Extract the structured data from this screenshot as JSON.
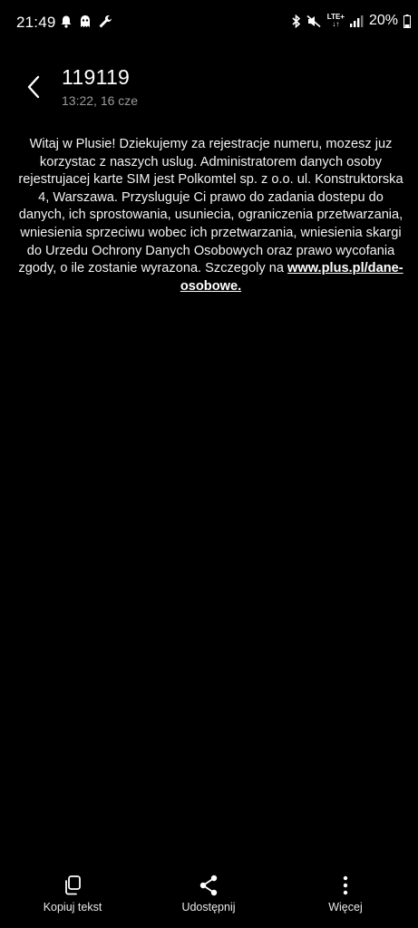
{
  "status_bar": {
    "time": "21:49",
    "network_label": "LTE+",
    "battery_percent": "20%",
    "icons": [
      "bell-icon",
      "ghost-icon",
      "wrench-icon",
      "bluetooth-icon",
      "mute-icon",
      "signal-icon",
      "battery-icon"
    ]
  },
  "header": {
    "sender": "119119",
    "timestamp": "13:22, 16 cze"
  },
  "message": {
    "body": "Witaj w Plusie! Dziekujemy za rejestracje numeru, mozesz juz korzystac z naszych uslug. Administratorem danych osoby rejestrujacej karte SIM jest Polkomtel sp. z o.o. ul. Konstruktorska 4, Warszawa. Przysluguje Ci prawo do zadania dostepu do danych, ich sprostowania, usuniecia, ograniczenia przetwarzania, wniesienia sprzeciwu wobec ich przetwarzania, wniesienia skargi do Urzedu Ochrony Danych Osobowych oraz prawo wycofania zgody, o ile zostanie wyrazona. Szczegoly na",
    "link": "www.plus.pl/dane-osobowe."
  },
  "toolbar": {
    "copy_label": "Kopiuj tekst",
    "share_label": "Udostępnij",
    "more_label": "Więcej"
  },
  "colors": {
    "background": "#000000",
    "text": "#ffffff",
    "timestamp": "#9a9a9a"
  }
}
